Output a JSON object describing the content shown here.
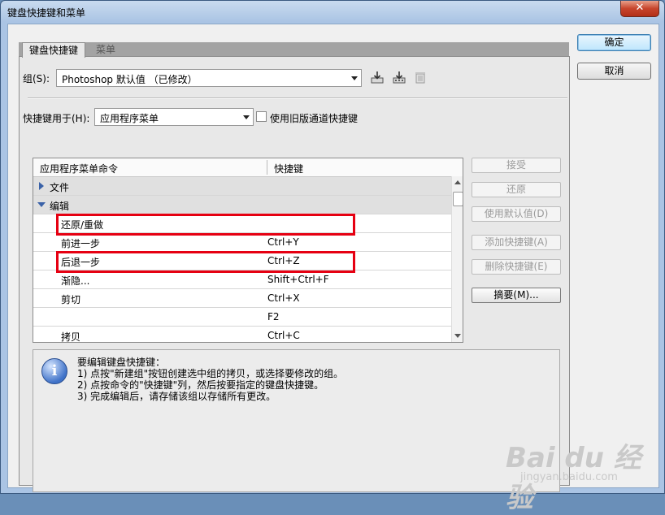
{
  "window": {
    "title": "键盘快捷键和菜单",
    "close_glyph": "✕"
  },
  "tabs": [
    {
      "label": "键盘快捷键"
    },
    {
      "label": "菜单"
    }
  ],
  "set": {
    "label": "组(S):",
    "value": "Photoshop 默认值 （已修改）"
  },
  "shortcuts_for": {
    "label": "快捷键用于(H):",
    "value": "应用程序菜单"
  },
  "legacy_checkbox": {
    "label": "使用旧版通道快捷键",
    "checked": false
  },
  "table": {
    "headers": [
      "应用程序菜单命令",
      "快捷键"
    ],
    "rows": [
      {
        "command": "文件",
        "shortcut": "",
        "type": "group-collapsed"
      },
      {
        "command": "编辑",
        "shortcut": "",
        "type": "group-expanded"
      },
      {
        "command": "还原/重做",
        "shortcut": "",
        "highlighted": true
      },
      {
        "command": "前进一步",
        "shortcut": "Ctrl+Y"
      },
      {
        "command": "后退一步",
        "shortcut": "Ctrl+Z",
        "highlighted": true
      },
      {
        "command": "渐隐...",
        "shortcut": "Shift+Ctrl+F"
      },
      {
        "command": "剪切",
        "shortcut": "Ctrl+X"
      },
      {
        "command": "",
        "shortcut": "F2"
      },
      {
        "command": "拷贝",
        "shortcut": "Ctrl+C"
      }
    ]
  },
  "side_buttons": {
    "accept": "接受",
    "undo": "还原",
    "use_default": "使用默认值(D)",
    "add_shortcut": "添加快捷键(A)",
    "delete_shortcut": "删除快捷键(E)",
    "summarize": "摘要(M)..."
  },
  "info": {
    "icon_glyph": "i",
    "lines": [
      "要编辑键盘快捷键：",
      "1) 点按\"新建组\"按钮创建选中组的拷贝，或选择要修改的组。",
      "2) 点按命令的\"快捷键\"列，然后按要指定的键盘快捷键。",
      "3) 完成编辑后，请存储该组以存储所有更改。"
    ]
  },
  "dialog_buttons": {
    "ok": "确定",
    "cancel": "取消"
  },
  "watermark": {
    "brand": "Bai du 经验",
    "url": "jingyan.baidu.com"
  },
  "colors": {
    "highlight": "#e60012",
    "tree_arrow": "#3a62a8",
    "title_bar": "#aac4e4"
  }
}
